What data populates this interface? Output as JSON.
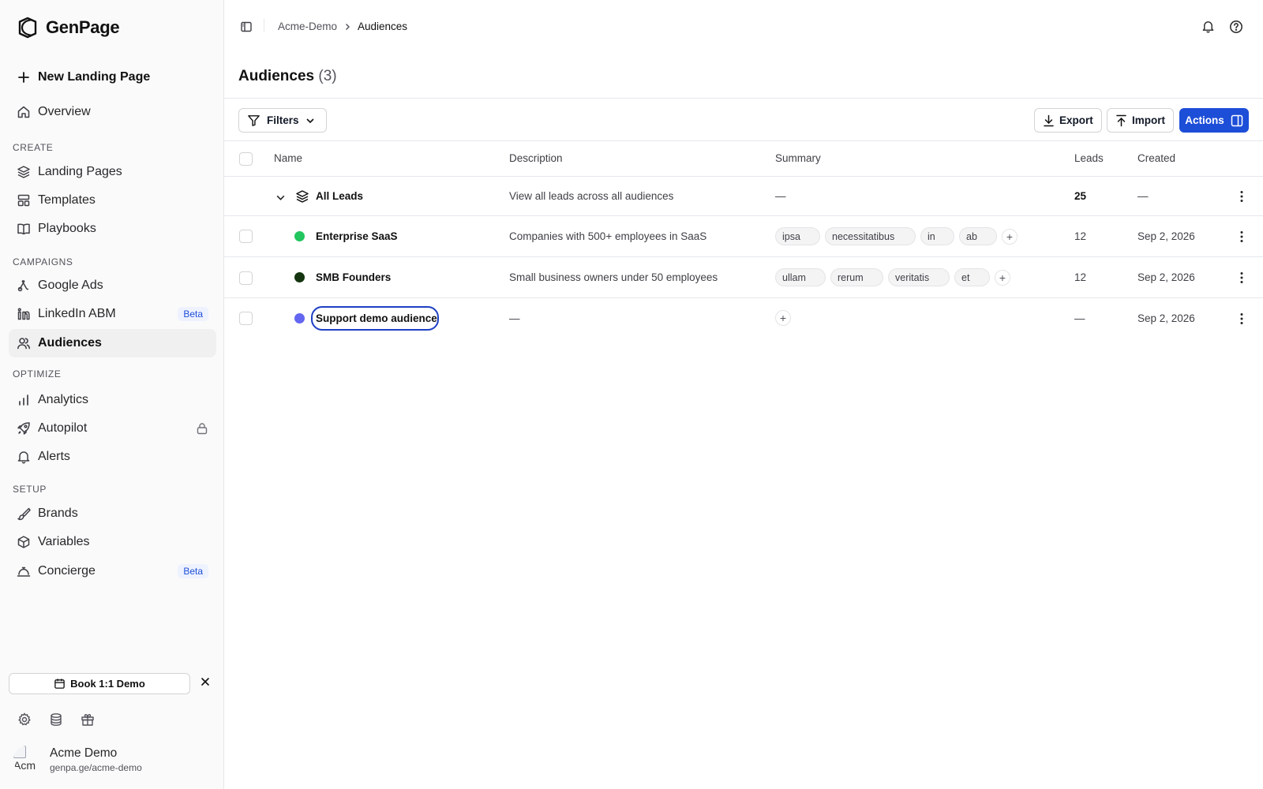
{
  "app": {
    "name": "GenPage"
  },
  "sidebar": {
    "new_page_label": "New Landing Page",
    "overview_label": "Overview",
    "sections": {
      "create": "CREATE",
      "campaigns": "CAMPAIGNS",
      "optimize": "OPTIMIZE",
      "setup": "SETUP"
    },
    "items": {
      "landing_pages": "Landing Pages",
      "templates": "Templates",
      "playbooks": "Playbooks",
      "google_ads": "Google Ads",
      "linkedin_abm": "LinkedIn ABM",
      "audiences": "Audiences",
      "analytics": "Analytics",
      "autopilot": "Autopilot",
      "alerts": "Alerts",
      "brands": "Brands",
      "variables": "Variables",
      "concierge": "Concierge"
    },
    "beta_badge": "Beta",
    "demo_button": "Book 1:1 Demo",
    "account": {
      "name": "Acme Demo",
      "url": "genpa.ge/acme-demo",
      "avatar_alt": "Acm"
    }
  },
  "breadcrumb": {
    "workspace": "Acme-Demo",
    "current": "Audiences"
  },
  "page": {
    "title": "Audiences",
    "count": "(3)"
  },
  "toolbar": {
    "filters": "Filters",
    "export": "Export",
    "import": "Import",
    "actions": "Actions"
  },
  "table": {
    "headers": {
      "name": "Name",
      "description": "Description",
      "summary": "Summary",
      "leads": "Leads",
      "created": "Created"
    },
    "all_leads": {
      "name": "All Leads",
      "description": "View all leads across all audiences",
      "summary": "—",
      "leads": "25",
      "created": "—"
    },
    "rows": [
      {
        "name": "Enterprise SaaS",
        "color": "#22c55e",
        "description": "Companies with 500+ employees in SaaS",
        "tags": [
          "ipsa",
          "necessitatibus",
          "in",
          "ab"
        ],
        "leads": "12",
        "created": "Sep 2, 2026"
      },
      {
        "name": "SMB Founders",
        "color": "#14350f",
        "description": "Small business owners under 50 employees",
        "tags": [
          "ullam",
          "rerum",
          "veritatis",
          "et"
        ],
        "leads": "12",
        "created": "Sep 2, 2026"
      },
      {
        "name": "Support demo audience",
        "color": "#6366f1",
        "description": "—",
        "tags": [],
        "leads": "—",
        "created": "Sep 2, 2026"
      }
    ]
  },
  "colors": {
    "accent": "#1d4ed8",
    "sidebar_bg": "#fafafa",
    "active_item_bg": "#f0f0f1"
  }
}
